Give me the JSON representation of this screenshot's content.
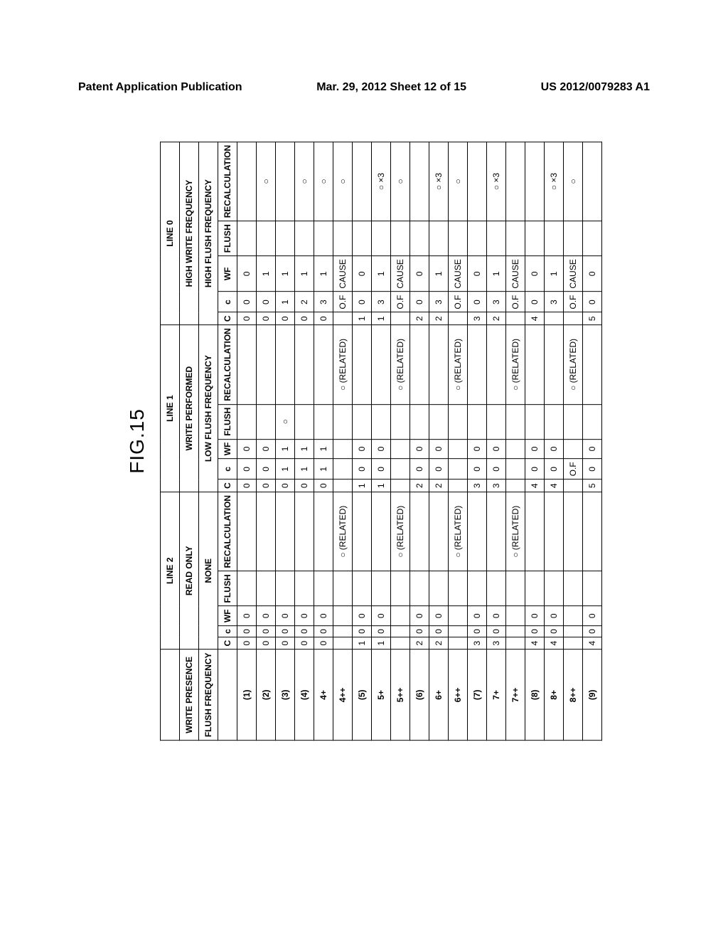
{
  "header": {
    "left": "Patent Application Publication",
    "center": "Mar. 29, 2012  Sheet 12 of 15",
    "right": "US 2012/0079283 A1"
  },
  "figure_label": "FIG.15",
  "table": {
    "top_blank": "",
    "top_labels": {
      "line2": "LINE 2",
      "line1": "LINE 1",
      "line0": "LINE 0"
    },
    "row_titles": {
      "write_presence": "WRITE PRESENCE",
      "flush_frequency": "FLUSH FREQUENCY"
    },
    "line2": {
      "write_presence": "READ ONLY",
      "flush_frequency": "NONE",
      "cols": {
        "C": "C",
        "c": "c",
        "WF": "WF",
        "FL": "FLUSH",
        "RC": "RECALCULATION"
      }
    },
    "line1": {
      "write_presence": "WRITE PERFORMED",
      "flush_frequency": "LOW FLUSH FREQUENCY",
      "cols": {
        "C": "C",
        "c": "c",
        "WF": "WF",
        "FL": "FLUSH",
        "RC": "RECALCULATION"
      }
    },
    "line0": {
      "write_presence": "HIGH WRITE FREQUENCY",
      "flush_frequency": "HIGH FLUSH FREQUENCY",
      "cols": {
        "C": "C",
        "c": "c",
        "WF": "WF",
        "FL": "FLUSH",
        "RC": "RECALCULATION"
      }
    },
    "rows": [
      {
        "label": "(1)",
        "l2": {
          "C": "0",
          "c": "0",
          "WF": "0",
          "FL": "",
          "RC": ""
        },
        "l1": {
          "C": "0",
          "c": "0",
          "WF": "0",
          "FL": "",
          "RC": ""
        },
        "l0": {
          "C": "0",
          "c": "0",
          "WF": "0",
          "FL": "",
          "RC": ""
        }
      },
      {
        "label": "(2)",
        "l2": {
          "C": "0",
          "c": "0",
          "WF": "0",
          "FL": "",
          "RC": ""
        },
        "l1": {
          "C": "0",
          "c": "0",
          "WF": "0",
          "FL": "",
          "RC": ""
        },
        "l0": {
          "C": "0",
          "c": "0",
          "WF": "1",
          "FL": "",
          "RC": "○"
        }
      },
      {
        "label": "(3)",
        "l2": {
          "C": "0",
          "c": "0",
          "WF": "0",
          "FL": "",
          "RC": ""
        },
        "l1": {
          "C": "0",
          "c": "1",
          "WF": "1",
          "FL": "○",
          "RC": ""
        },
        "l0": {
          "C": "0",
          "c": "1",
          "WF": "1",
          "FL": "",
          "RC": ""
        }
      },
      {
        "label": "(4)",
        "l2": {
          "C": "0",
          "c": "0",
          "WF": "0",
          "FL": "",
          "RC": ""
        },
        "l1": {
          "C": "0",
          "c": "1",
          "WF": "1",
          "FL": "",
          "RC": ""
        },
        "l0": {
          "C": "0",
          "c": "2",
          "WF": "1",
          "FL": "",
          "RC": "○"
        }
      },
      {
        "label": "4+",
        "l2": {
          "C": "0",
          "c": "0",
          "WF": "0",
          "FL": "",
          "RC": ""
        },
        "l1": {
          "C": "0",
          "c": "1",
          "WF": "1",
          "FL": "",
          "RC": ""
        },
        "l0": {
          "C": "0",
          "c": "3",
          "WF": "1",
          "FL": "",
          "RC": "○"
        }
      },
      {
        "label": "4++",
        "l2": {
          "C": "",
          "c": "",
          "WF": "",
          "FL": "",
          "RC": "○ (RELATED)"
        },
        "l1": {
          "C": "",
          "c": "",
          "WF": "",
          "FL": "",
          "RC": "○ (RELATED)"
        },
        "l0": {
          "C": "",
          "c": "O.F",
          "WF": "CAUSE",
          "FL": "",
          "RC": "○"
        }
      },
      {
        "label": "(5)",
        "l2": {
          "C": "1",
          "c": "0",
          "WF": "0",
          "FL": "",
          "RC": ""
        },
        "l1": {
          "C": "1",
          "c": "0",
          "WF": "0",
          "FL": "",
          "RC": ""
        },
        "l0": {
          "C": "1",
          "c": "0",
          "WF": "0",
          "FL": "",
          "RC": ""
        }
      },
      {
        "label": "5+",
        "l2": {
          "C": "1",
          "c": "0",
          "WF": "0",
          "FL": "",
          "RC": ""
        },
        "l1": {
          "C": "1",
          "c": "0",
          "WF": "0",
          "FL": "",
          "RC": ""
        },
        "l0": {
          "C": "1",
          "c": "3",
          "WF": "1",
          "FL": "",
          "RC": "○ ×3"
        }
      },
      {
        "label": "5++",
        "l2": {
          "C": "",
          "c": "",
          "WF": "",
          "FL": "",
          "RC": "○ (RELATED)"
        },
        "l1": {
          "C": "",
          "c": "",
          "WF": "",
          "FL": "",
          "RC": "○ (RELATED)"
        },
        "l0": {
          "C": "",
          "c": "O.F",
          "WF": "CAUSE",
          "FL": "",
          "RC": "○"
        }
      },
      {
        "label": "(6)",
        "l2": {
          "C": "2",
          "c": "0",
          "WF": "0",
          "FL": "",
          "RC": ""
        },
        "l1": {
          "C": "2",
          "c": "0",
          "WF": "0",
          "FL": "",
          "RC": ""
        },
        "l0": {
          "C": "2",
          "c": "0",
          "WF": "0",
          "FL": "",
          "RC": ""
        }
      },
      {
        "label": "6+",
        "l2": {
          "C": "2",
          "c": "0",
          "WF": "0",
          "FL": "",
          "RC": ""
        },
        "l1": {
          "C": "2",
          "c": "0",
          "WF": "0",
          "FL": "",
          "RC": ""
        },
        "l0": {
          "C": "2",
          "c": "3",
          "WF": "1",
          "FL": "",
          "RC": "○ ×3"
        }
      },
      {
        "label": "6++",
        "l2": {
          "C": "",
          "c": "",
          "WF": "",
          "FL": "",
          "RC": "○ (RELATED)"
        },
        "l1": {
          "C": "",
          "c": "",
          "WF": "",
          "FL": "",
          "RC": "○ (RELATED)"
        },
        "l0": {
          "C": "",
          "c": "O.F",
          "WF": "CAUSE",
          "FL": "",
          "RC": "○"
        }
      },
      {
        "label": "(7)",
        "l2": {
          "C": "3",
          "c": "0",
          "WF": "0",
          "FL": "",
          "RC": ""
        },
        "l1": {
          "C": "3",
          "c": "0",
          "WF": "0",
          "FL": "",
          "RC": ""
        },
        "l0": {
          "C": "3",
          "c": "0",
          "WF": "0",
          "FL": "",
          "RC": ""
        }
      },
      {
        "label": "7+",
        "l2": {
          "C": "3",
          "c": "0",
          "WF": "0",
          "FL": "",
          "RC": ""
        },
        "l1": {
          "C": "3",
          "c": "0",
          "WF": "0",
          "FL": "",
          "RC": ""
        },
        "l0": {
          "C": "2",
          "c": "3",
          "WF": "1",
          "FL": "",
          "RC": "○ ×3"
        }
      },
      {
        "label": "7++",
        "l2": {
          "C": "",
          "c": "",
          "WF": "",
          "FL": "",
          "RC": "○ (RELATED)"
        },
        "l1": {
          "C": "",
          "c": "",
          "WF": "",
          "FL": "",
          "RC": "○ (RELATED)"
        },
        "l0": {
          "C": "",
          "c": "O.F",
          "WF": "CAUSE",
          "FL": "",
          "RC": ""
        }
      },
      {
        "label": "(8)",
        "l2": {
          "C": "4",
          "c": "0",
          "WF": "0",
          "FL": "",
          "RC": ""
        },
        "l1": {
          "C": "4",
          "c": "0",
          "WF": "0",
          "FL": "",
          "RC": ""
        },
        "l0": {
          "C": "4",
          "c": "0",
          "WF": "0",
          "FL": "",
          "RC": ""
        }
      },
      {
        "label": "8+",
        "l2": {
          "C": "4",
          "c": "0",
          "WF": "0",
          "FL": "",
          "RC": ""
        },
        "l1": {
          "C": "4",
          "c": "0",
          "WF": "0",
          "FL": "",
          "RC": ""
        },
        "l0": {
          "C": "",
          "c": "3",
          "WF": "1",
          "FL": "",
          "RC": "○ ×3"
        }
      },
      {
        "label": "8++",
        "l2": {
          "C": "",
          "c": "",
          "WF": "",
          "FL": "",
          "RC": ""
        },
        "l1": {
          "C": "",
          "c": "O.F",
          "WF": "",
          "FL": "",
          "RC": "○ (RELATED)"
        },
        "l0": {
          "C": "",
          "c": "O.F",
          "WF": "CAUSE",
          "FL": "",
          "RC": "○"
        }
      },
      {
        "label": "(9)",
        "l2": {
          "C": "4",
          "c": "0",
          "WF": "0",
          "FL": "",
          "RC": ""
        },
        "l1": {
          "C": "5",
          "c": "0",
          "WF": "0",
          "FL": "",
          "RC": ""
        },
        "l0": {
          "C": "5",
          "c": "0",
          "WF": "0",
          "FL": "",
          "RC": ""
        }
      }
    ]
  }
}
